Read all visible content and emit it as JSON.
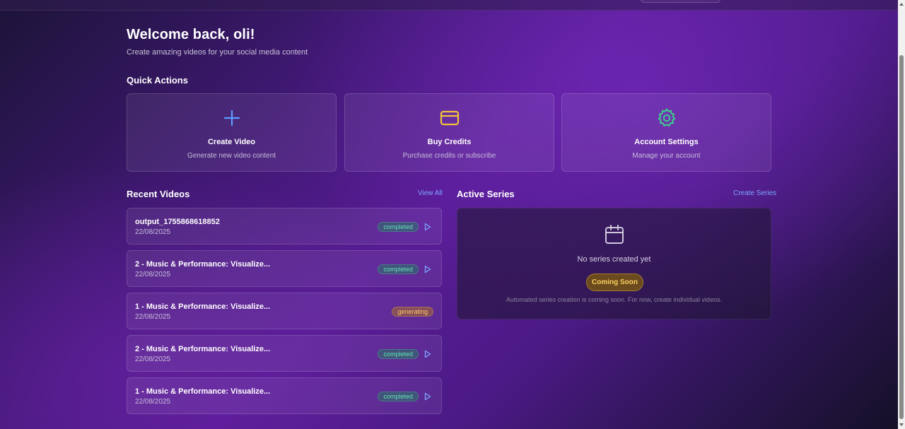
{
  "header": {
    "title": "Welcome back, oli!",
    "subtitle": "Create amazing videos for your social media content"
  },
  "quick_actions": {
    "title": "Quick Actions",
    "cards": [
      {
        "label": "Create Video",
        "description": "Generate new video content",
        "icon": "plus-icon",
        "color": "#5b9dff"
      },
      {
        "label": "Buy Credits",
        "description": "Purchase credits or subscribe",
        "icon": "credit-card-icon",
        "color": "#f5c33b"
      },
      {
        "label": "Account Settings",
        "description": "Manage your account",
        "icon": "gear-icon",
        "color": "#3ecf8e"
      }
    ]
  },
  "recent_videos": {
    "title": "Recent Videos",
    "view_all_label": "View All",
    "items": [
      {
        "name": "output_1755868618852",
        "date": "22/08/2025",
        "status": "completed"
      },
      {
        "name": "2 - Music & Performance: Visualize...",
        "date": "22/08/2025",
        "status": "completed"
      },
      {
        "name": "1 - Music & Performance: Visualize...",
        "date": "22/08/2025",
        "status": "generating"
      },
      {
        "name": "2 - Music & Performance: Visualize...",
        "date": "22/08/2025",
        "status": "completed"
      },
      {
        "name": "1 - Music & Performance: Visualize...",
        "date": "22/08/2025",
        "status": "completed"
      }
    ]
  },
  "active_series": {
    "title": "Active Series",
    "create_label": "Create Series",
    "empty_text": "No series created yet",
    "badge": "Coming Soon",
    "note": "Automated series creation is coming soon. For now, create individual videos.",
    "icon": "calendar-icon"
  },
  "colors": {
    "accent_link": "#7ea6ff",
    "completed": "#63e2b1",
    "generating": "#f7c86a"
  }
}
